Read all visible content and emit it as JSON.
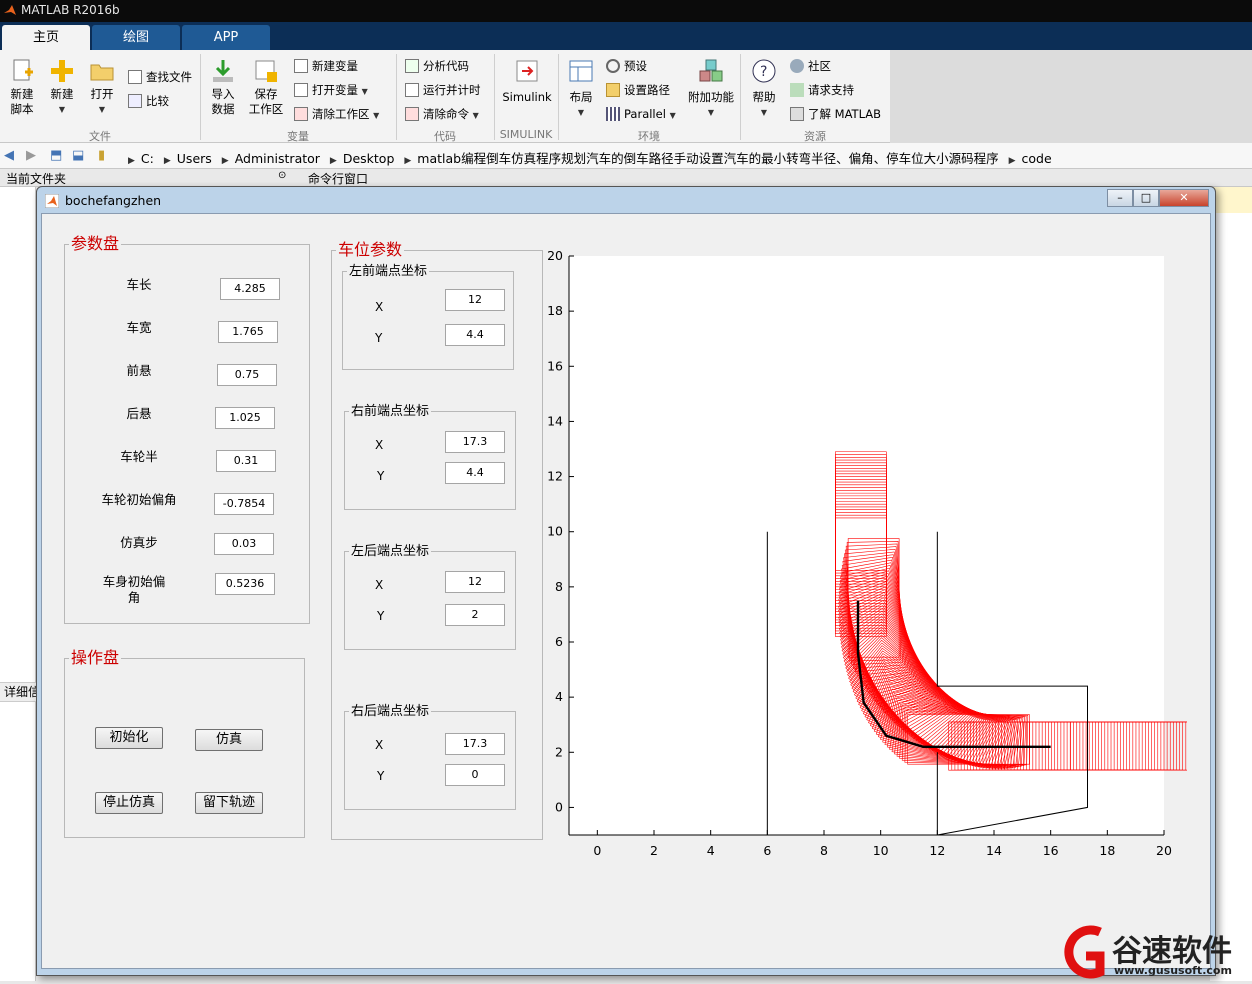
{
  "app": {
    "title": "MATLAB R2016b"
  },
  "tabs": [
    "主页",
    "绘图",
    "APP"
  ],
  "ribbon": {
    "file": {
      "new_script": "新建\n脚本",
      "new": "新建",
      "open": "打开",
      "find_files": "查找文件",
      "compare": "比较",
      "group": "文件"
    },
    "variable": {
      "import": "导入\n数据",
      "save_ws": "保存\n工作区",
      "new_var": "新建变量",
      "open_var": "打开变量",
      "clear_ws": "清除工作区",
      "group": "变量"
    },
    "code": {
      "analyze": "分析代码",
      "run_time": "运行并计时",
      "clear_cmd": "清除命令",
      "group": "代码"
    },
    "simulink": {
      "label": "Simulink",
      "group": "SIMULINK"
    },
    "env": {
      "layout": "布局",
      "prefs": "预设",
      "set_path": "设置路径",
      "parallel": "Parallel",
      "addons": "附加功能",
      "group": "环境"
    },
    "resources": {
      "help": "帮助",
      "community": "社区",
      "request_support": "请求支持",
      "learn": "了解 MATLAB",
      "group": "资源"
    }
  },
  "path": [
    "C:",
    "Users",
    "Administrator",
    "Desktop",
    "matlab编程倒车仿真程序规划汽车的倒车路径手动设置汽车的最小转弯半径、偏角、停车位大小源码程序",
    "code"
  ],
  "panels": {
    "current_folder": "当前文件夹",
    "command_window": "命令行窗口",
    "details": "详细信息"
  },
  "figure": {
    "title": "bochefangzhen",
    "param_panel": {
      "title": "参数盘",
      "fields": [
        {
          "label": "车长",
          "value": "4.285"
        },
        {
          "label": "车宽",
          "value": "1.765"
        },
        {
          "label": "前悬",
          "value": "0.75"
        },
        {
          "label": "后悬",
          "value": "1.025"
        },
        {
          "label": "车轮半",
          "value": "0.31"
        },
        {
          "label": "车轮初始偏角",
          "value": "-0.7854"
        },
        {
          "label": "仿真步",
          "value": "0.03"
        },
        {
          "label": "车身初始偏\n角",
          "value": "0.5236"
        }
      ]
    },
    "ops_panel": {
      "title": "操作盘",
      "buttons": {
        "init": "初始化",
        "simulate": "仿真",
        "stop": "停止仿真",
        "trace": "留下轨迹"
      }
    },
    "spot_panel": {
      "title": "车位参数",
      "groups": [
        {
          "title": "左前端点坐标",
          "x": "12",
          "y": "4.4"
        },
        {
          "title": "右前端点坐标",
          "x": "17.3",
          "y": "4.4"
        },
        {
          "title": "左后端点坐标",
          "x": "12",
          "y": "2"
        },
        {
          "title": "右后端点坐标",
          "x": "17.3",
          "y": "0"
        }
      ],
      "x_label": "X",
      "y_label": "Y"
    }
  },
  "chart_data": {
    "type": "line",
    "title": "",
    "xlabel": "",
    "ylabel": "",
    "xlim": [
      -1,
      20
    ],
    "ylim": [
      -1,
      20
    ],
    "x_ticks": [
      0,
      2,
      4,
      6,
      8,
      10,
      12,
      14,
      16,
      18,
      20
    ],
    "y_ticks": [
      0,
      2,
      4,
      6,
      8,
      10,
      12,
      14,
      16,
      18,
      20
    ],
    "grid": false,
    "series": [
      {
        "color": "#000000",
        "x": [
          6,
          6
        ],
        "y": [
          10,
          -1
        ]
      },
      {
        "color": "#000000",
        "x": [
          12,
          12,
          17.3,
          17.3,
          12
        ],
        "y": [
          10,
          4.4,
          4.4,
          0,
          -1
        ]
      },
      {
        "color": "#000000",
        "x": [
          12,
          12
        ],
        "y": [
          2,
          -1
        ]
      },
      {
        "color": "#000000",
        "x": [
          16,
          13.5,
          11.5,
          10.2,
          9.4,
          9.2,
          9.2
        ],
        "y": [
          2.2,
          2.2,
          2.2,
          2.6,
          3.8,
          5.6,
          7.5
        ]
      }
    ],
    "colors": {
      "car_outline": "#ff0000",
      "lines": "#000000",
      "background": "#ffffff"
    }
  },
  "watermark": {
    "brand": "谷速软件",
    "url": "www.gususoft.com"
  }
}
